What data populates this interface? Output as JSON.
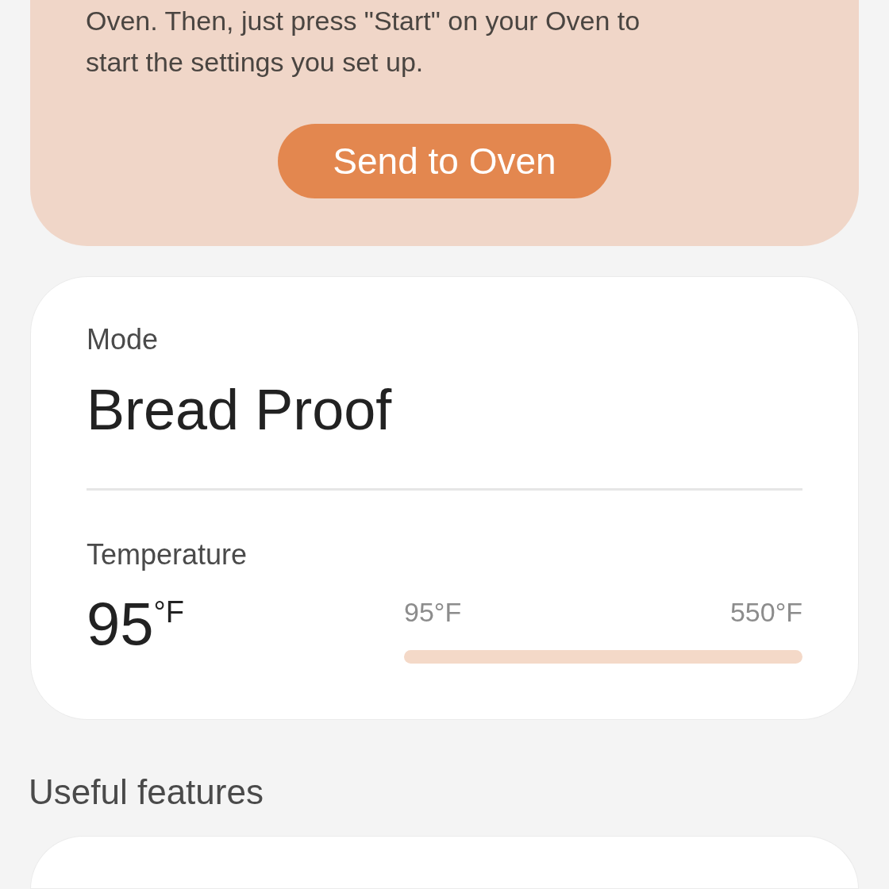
{
  "instructions": {
    "lines": [
      "Oven. Then, just press \"Start\" on your Oven to",
      "start the settings you set up."
    ],
    "button": "Send to Oven"
  },
  "mode": {
    "label": "Mode",
    "value": "Bread Proof"
  },
  "temperature": {
    "label": "Temperature",
    "value": "95",
    "unit": "°F",
    "min_label": "95°F",
    "max_label": "550°F",
    "level": 0
  },
  "section_title": "Useful features"
}
